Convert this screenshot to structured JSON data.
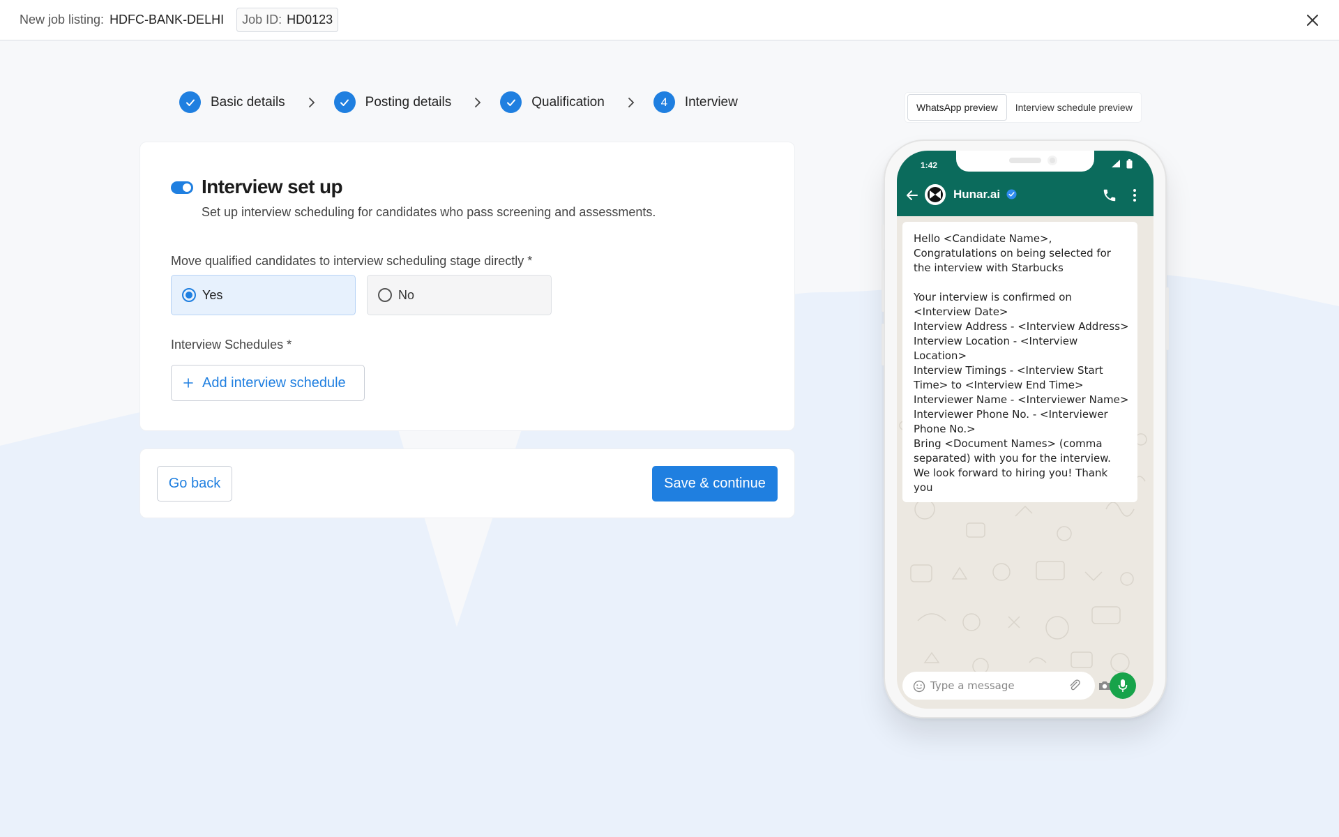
{
  "topbar": {
    "listing_label": "New job listing:",
    "listing_value": "HDFC-BANK-DELHI",
    "jobid_label": "Job ID:",
    "jobid_value": "HD0123"
  },
  "stepper": {
    "steps": [
      {
        "label": "Basic details",
        "state": "done"
      },
      {
        "label": "Posting details",
        "state": "done"
      },
      {
        "label": "Qualification",
        "state": "done"
      },
      {
        "label": "Interview",
        "state": "active",
        "number": "4"
      }
    ]
  },
  "interview": {
    "title": "Interview set up",
    "subtitle": "Set up interview scheduling for candidates who pass screening and assessments.",
    "question": "Move qualified candidates to interview scheduling stage directly *",
    "options": [
      {
        "label": "Yes",
        "selected": true
      },
      {
        "label": "No",
        "selected": false
      }
    ],
    "schedules_label": "Interview Schedules *",
    "add_schedule": "Add interview schedule"
  },
  "footer": {
    "back": "Go back",
    "save": "Save & continue"
  },
  "preview": {
    "tabs": [
      "WhatsApp preview",
      "Interview schedule preview"
    ],
    "active_tab": 0,
    "phone": {
      "time": "1:42",
      "contact": "Hunar.ai",
      "message": "Hello <Candidate Name>,\nCongratulations on being selected for the interview with Starbucks\n\nYour interview is confirmed on <Interview Date>\nInterview Address - <Interview Address>\nInterview Location - <Interview Location>\nInterview Timings - <Interview Start Time> to <Interview End Time>\nInterviewer Name - <Interviewer Name>\nInterviewer Phone No. - <Interviewer Phone No.>\nBring <Document Names> (comma separated) with you for the interview.\nWe look forward to hiring you! Thank you",
      "input_placeholder": "Type a message"
    }
  },
  "colors": {
    "primary": "#1f7fe0",
    "whatsapp_header": "#0b6b5c",
    "mic": "#17a34a",
    "bg_wave": "#eaf1fb"
  },
  "icons": [
    "check-icon",
    "chevron-right-icon",
    "close-icon",
    "plus-icon",
    "back-arrow-icon",
    "verified-icon",
    "phone-icon",
    "more-vertical-icon",
    "emoji-icon",
    "attachment-icon",
    "camera-icon",
    "mic-icon"
  ]
}
